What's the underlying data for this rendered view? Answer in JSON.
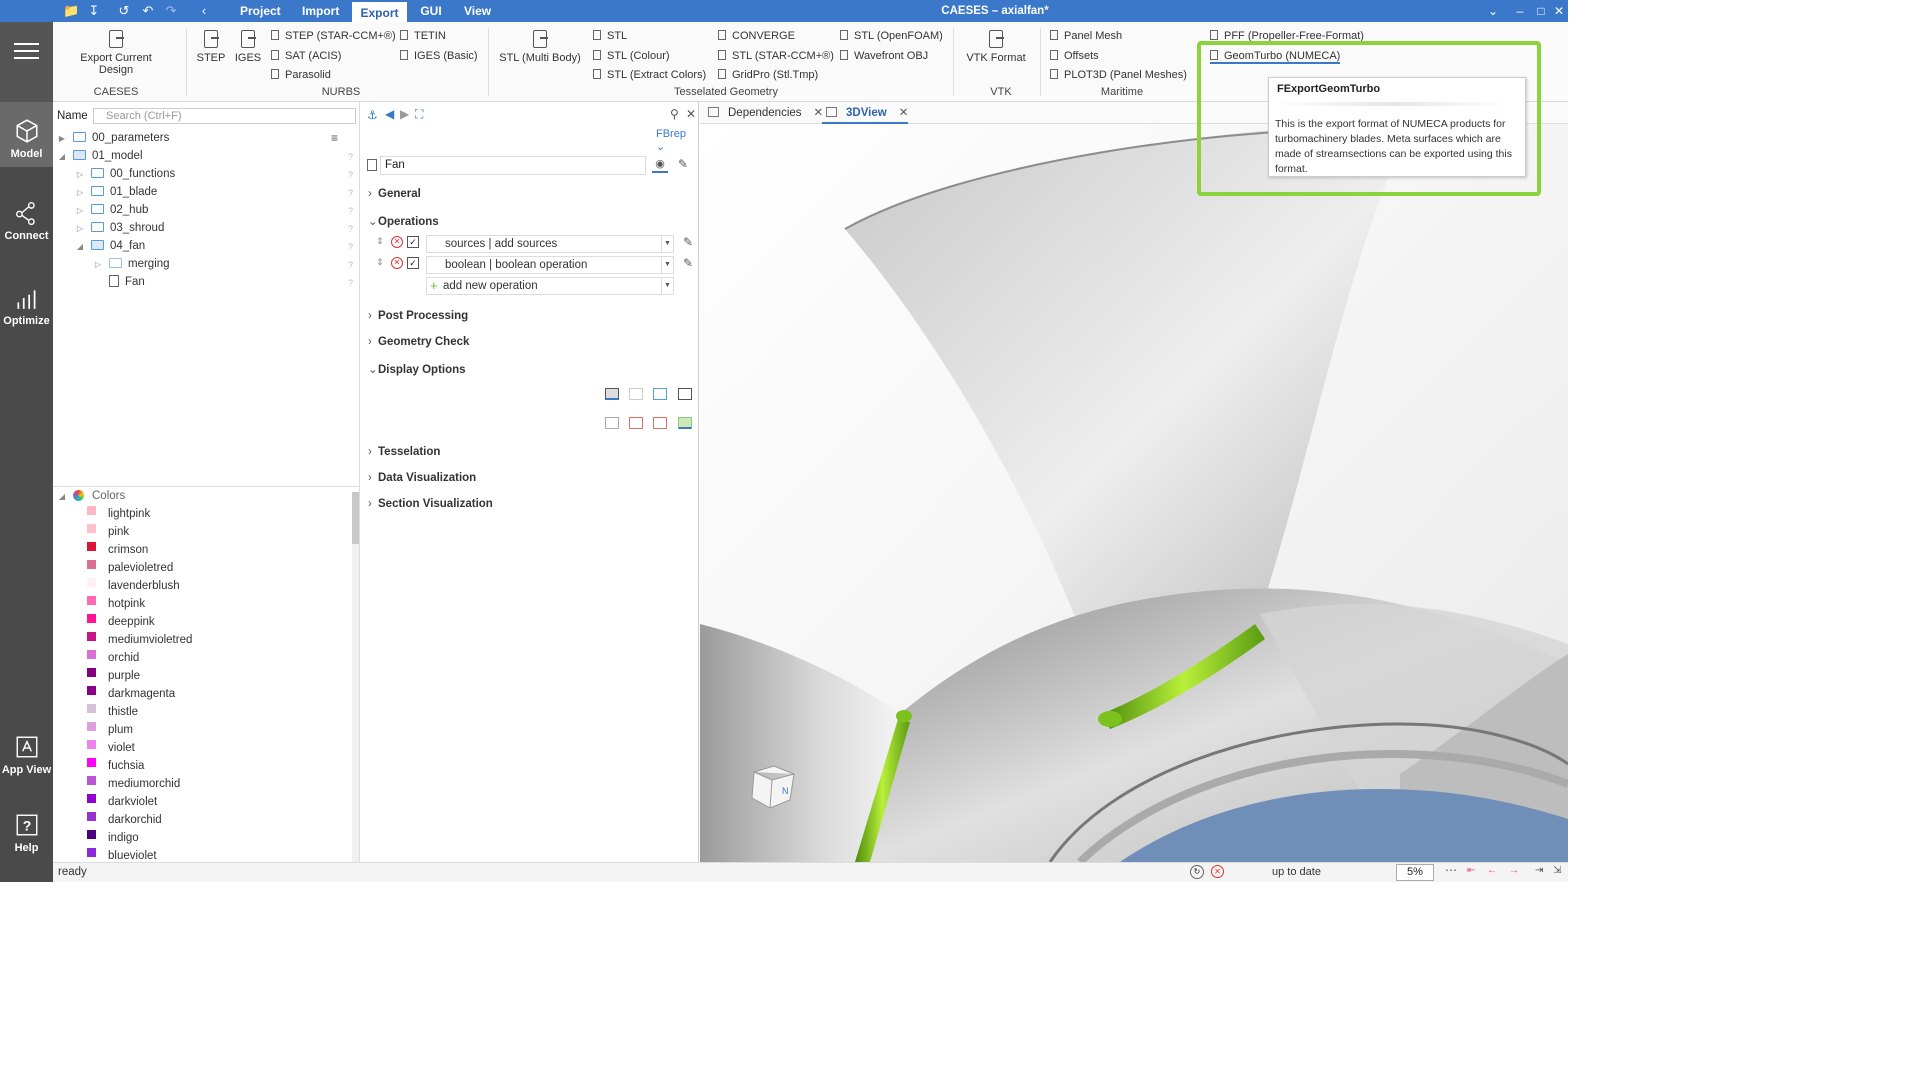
{
  "app": {
    "title": "CAESES – axialfan*",
    "status": "ready",
    "status_right": "up to date",
    "zoom": "5%"
  },
  "menu": {
    "tabs": [
      "Project",
      "Import",
      "Export",
      "GUI",
      "View"
    ],
    "active": "Export"
  },
  "sidebar": {
    "items": [
      "Model",
      "Connect",
      "Optimize",
      "App View",
      "Help"
    ]
  },
  "ribbon": {
    "caeses": {
      "label": "CAESES",
      "export_current": "Export Current Design"
    },
    "nurbs": {
      "label": "NURBS",
      "step": "STEP",
      "iges": "IGES",
      "small": [
        "STEP (STAR-CCM+®)",
        "SAT (ACIS)",
        "Parasolid",
        "TETIN",
        "IGES (Basic)"
      ]
    },
    "tesselated": {
      "label": "Tesselated Geometry",
      "stl_multi": "STL (Multi Body)",
      "small": [
        "STL",
        "STL (Colour)",
        "STL (Extract Colors)",
        "CONVERGE",
        "STL (STAR-CCM+®)",
        "GridPro (Stl.Tmp)",
        "STL (OpenFOAM)",
        "Wavefront OBJ"
      ]
    },
    "vtk": {
      "label": "VTK",
      "vtk_format": "VTK Format"
    },
    "maritime": {
      "label": "Maritime",
      "small": [
        "Panel Mesh",
        "Offsets",
        "PLOT3D (Panel Meshes)",
        "PFF (Propeller-Free-Format)",
        "GeomTurbo (NUMECA)"
      ]
    }
  },
  "tooltip": {
    "title": "FExportGeomTurbo",
    "body": "This is the export format of NUMECA products for turbomachinery blades. Meta surfaces which are made of streamsections can be exported using this format."
  },
  "tree": {
    "name_label": "Name",
    "search_placeholder": "Search (Ctrl+F)",
    "items": [
      "00_parameters",
      "01_model",
      "00_functions",
      "01_blade",
      "02_hub",
      "03_shroud",
      "04_fan",
      "merging",
      "Fan"
    ]
  },
  "colors": {
    "header": "Colors",
    "items": [
      {
        "name": "lightpink",
        "hex": "#ffb6c1"
      },
      {
        "name": "pink",
        "hex": "#ffc0cb"
      },
      {
        "name": "crimson",
        "hex": "#dc143c"
      },
      {
        "name": "palevioletred",
        "hex": "#db7093"
      },
      {
        "name": "lavenderblush",
        "hex": "#fff0f5"
      },
      {
        "name": "hotpink",
        "hex": "#ff69b4"
      },
      {
        "name": "deeppink",
        "hex": "#ff1493"
      },
      {
        "name": "mediumvioletred",
        "hex": "#c71585"
      },
      {
        "name": "orchid",
        "hex": "#da70d6"
      },
      {
        "name": "purple",
        "hex": "#800080"
      },
      {
        "name": "darkmagenta",
        "hex": "#8b008b"
      },
      {
        "name": "thistle",
        "hex": "#d8bfd8"
      },
      {
        "name": "plum",
        "hex": "#dda0dd"
      },
      {
        "name": "violet",
        "hex": "#ee82ee"
      },
      {
        "name": "fuchsia",
        "hex": "#ff00ff"
      },
      {
        "name": "mediumorchid",
        "hex": "#ba55d3"
      },
      {
        "name": "darkviolet",
        "hex": "#9400d3"
      },
      {
        "name": "darkorchid",
        "hex": "#9932cc"
      },
      {
        "name": "indigo",
        "hex": "#4b0082"
      },
      {
        "name": "blueviolet",
        "hex": "#8a2be2"
      }
    ]
  },
  "props": {
    "mode": "FBrep",
    "object_name": "Fan",
    "sections": [
      "General",
      "Operations",
      "Post Processing",
      "Geometry Check",
      "Display Options",
      "Tesselation",
      "Data Visualization",
      "Section Visualization"
    ],
    "operations": [
      "sources | add sources",
      "boolean | boolean operation"
    ],
    "add_operation": "add new operation"
  },
  "view_tabs": [
    "Dependencies",
    "3DView"
  ],
  "accent": "#3b78c9",
  "highlight": "#8cd23c"
}
